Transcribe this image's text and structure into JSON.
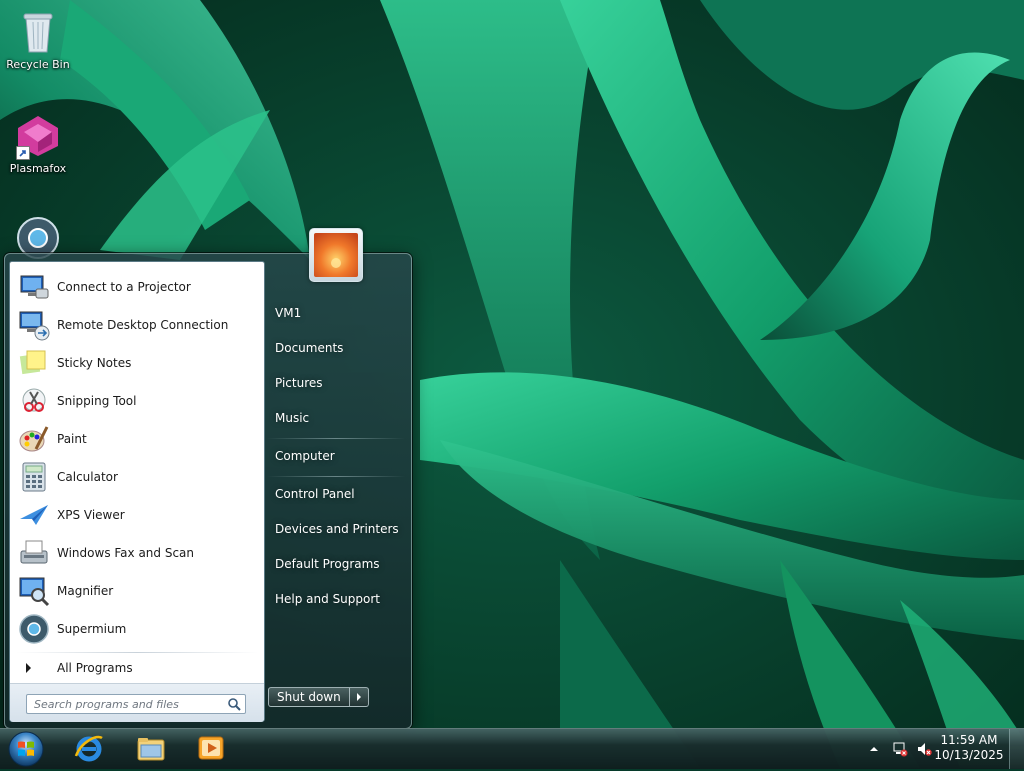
{
  "desktop": {
    "icons": [
      {
        "label": "Recycle Bin",
        "icon": "recycle-bin-icon"
      },
      {
        "label": "Plasmafox",
        "icon": "plasmafox-icon"
      },
      {
        "label": "",
        "icon": "supermium-icon"
      }
    ]
  },
  "start_menu": {
    "programs": [
      {
        "label": "Connect to a Projector",
        "icon": "projector-icon"
      },
      {
        "label": "Remote Desktop Connection",
        "icon": "remote-desktop-icon"
      },
      {
        "label": "Sticky Notes",
        "icon": "sticky-notes-icon"
      },
      {
        "label": "Snipping Tool",
        "icon": "snipping-tool-icon"
      },
      {
        "label": "Paint",
        "icon": "paint-icon"
      },
      {
        "label": "Calculator",
        "icon": "calculator-icon"
      },
      {
        "label": "XPS Viewer",
        "icon": "xps-viewer-icon"
      },
      {
        "label": "Windows Fax and Scan",
        "icon": "fax-scan-icon"
      },
      {
        "label": "Magnifier",
        "icon": "magnifier-icon"
      },
      {
        "label": "Supermium",
        "icon": "supermium-icon"
      }
    ],
    "all_programs": "All Programs",
    "search_placeholder": "Search programs and files",
    "places": [
      {
        "label": "VM1"
      },
      {
        "label": "Documents"
      },
      {
        "label": "Pictures"
      },
      {
        "label": "Music"
      },
      {
        "label": "Computer"
      },
      {
        "label": "Control Panel"
      },
      {
        "label": "Devices and Printers"
      },
      {
        "label": "Default Programs"
      },
      {
        "label": "Help and Support"
      }
    ],
    "shutdown_label": "Shut down"
  },
  "taskbar": {
    "pinned": [
      {
        "icon": "internet-explorer-icon"
      },
      {
        "icon": "file-explorer-icon"
      },
      {
        "icon": "media-player-icon"
      }
    ],
    "clock": {
      "time": "11:59 AM",
      "date": "10/13/2025"
    },
    "tray_icons": [
      "show-hidden-icons-icon",
      "network-icon",
      "volume-muted-icon"
    ]
  },
  "colors": {
    "wallpaper_dark": "#063a2a",
    "wallpaper_leaf": "#1fb57a",
    "menu_glass": "#28464b"
  }
}
